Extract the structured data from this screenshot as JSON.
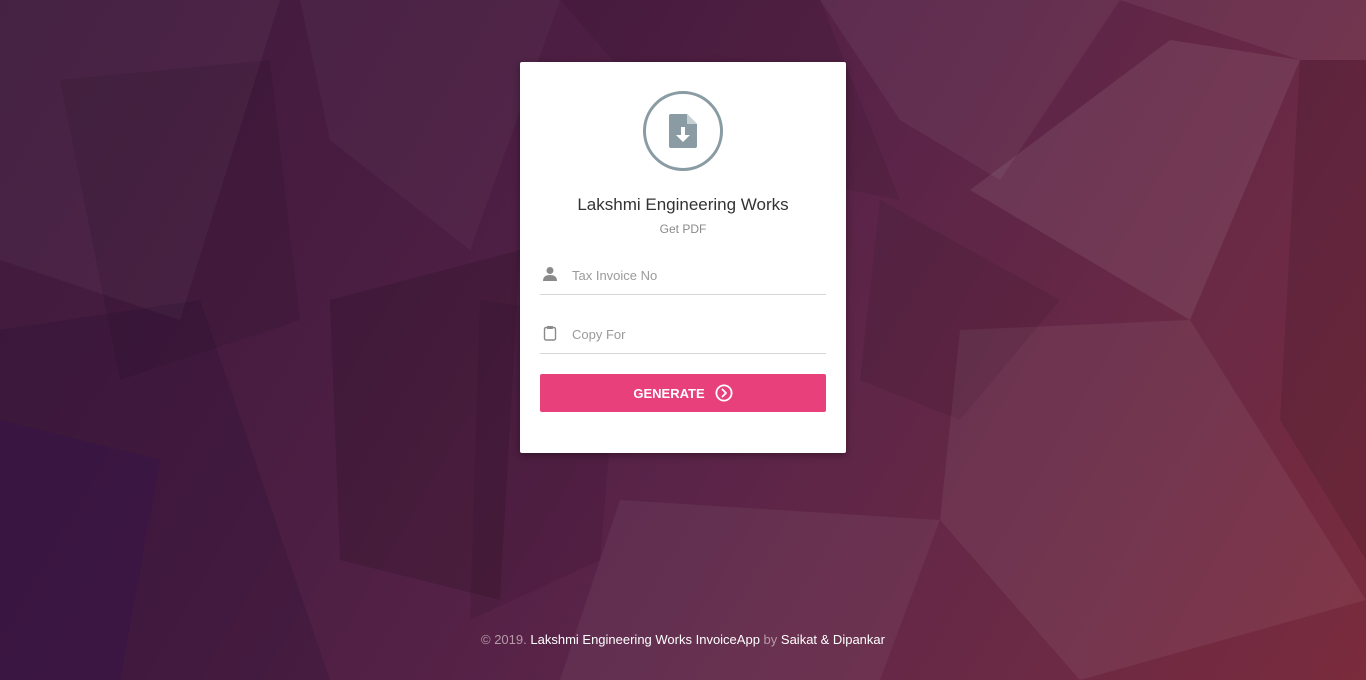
{
  "brand": {
    "title": "Lakshmi Engineering Works",
    "subtitle": "Get PDF",
    "logo_icon": "file-download-icon"
  },
  "form": {
    "invoice_field": {
      "placeholder": "Tax Invoice No",
      "value": "",
      "icon": "user-icon"
    },
    "copy_field": {
      "placeholder": "Copy For",
      "value": "",
      "icon": "clipboard-icon"
    },
    "generate_button": {
      "label": "GENERATE",
      "icon": "arrow-right-circle-icon"
    }
  },
  "footer": {
    "copyright": "© 2019.",
    "app_name": "Lakshmi Engineering Works InvoiceApp",
    "by": "by",
    "authors": "Saikat & Dipankar"
  },
  "colors": {
    "accent": "#e8407b",
    "logo_ring": "#8a9ba3",
    "background_dark": "#3e1a3c",
    "background_warm": "#7a2b3c"
  }
}
